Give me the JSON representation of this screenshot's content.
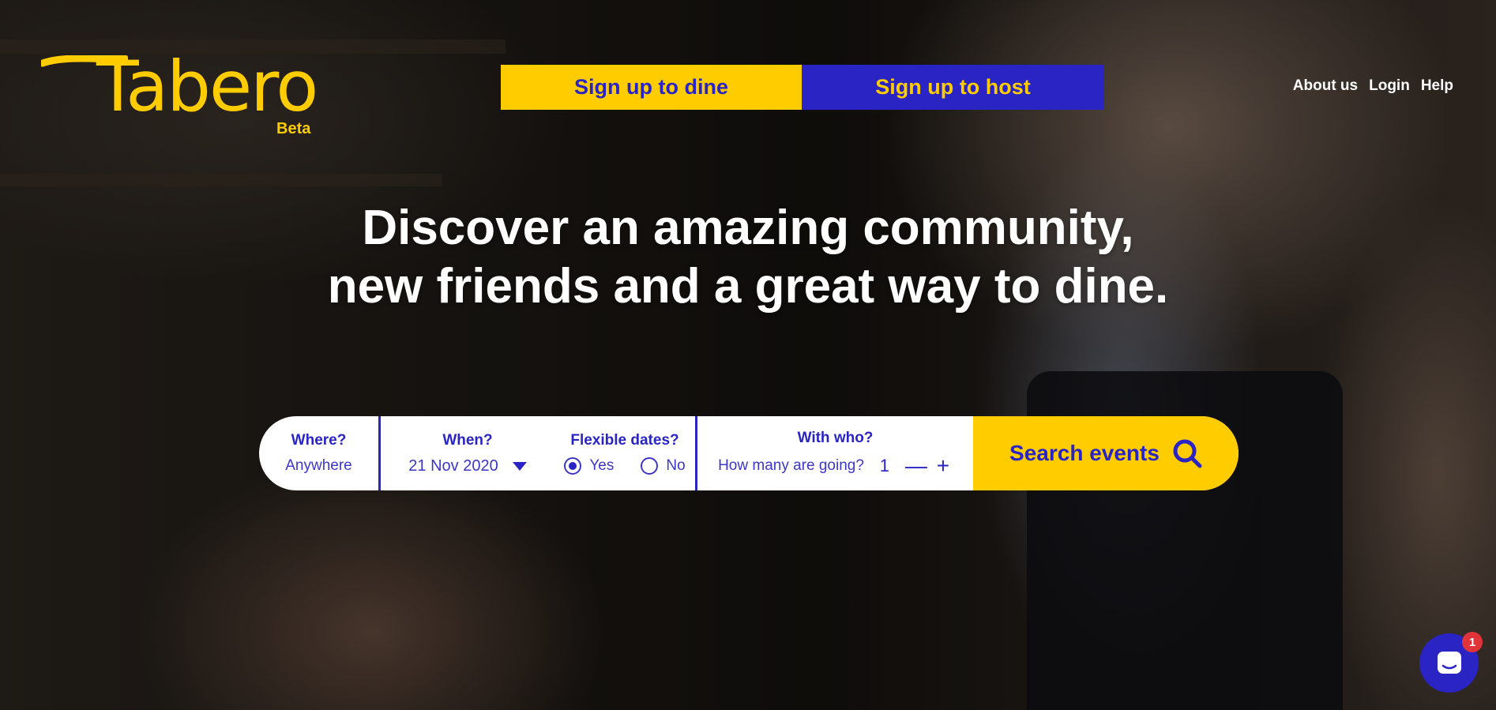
{
  "brand": {
    "name": "Tabero",
    "badge": "Beta",
    "color": "#ffcc00"
  },
  "cta": {
    "dine_label": "Sign up to dine",
    "host_label": "Sign up to host"
  },
  "nav": {
    "items": [
      {
        "label": "About us"
      },
      {
        "label": "Login"
      },
      {
        "label": "Help"
      }
    ]
  },
  "hero": {
    "line1": "Discover an amazing community,",
    "line2": "new friends and a great way to dine."
  },
  "search": {
    "where_label": "Where?",
    "where_value": "Anywhere",
    "when_label": "When?",
    "when_value": "21 Nov 2020",
    "flexible_label": "Flexible dates?",
    "flexible_yes": "Yes",
    "flexible_no": "No",
    "flexible_selected": "Yes",
    "who_label": "With who?",
    "who_prompt": "How many are going?",
    "who_count": "1",
    "button_label": "Search events",
    "button_icon": "search-icon"
  },
  "chat": {
    "icon": "chat-icon",
    "badge_count": "1"
  },
  "colors": {
    "accent_yellow": "#ffcc00",
    "accent_blue": "#2a24c4",
    "badge_red": "#e1343a"
  }
}
